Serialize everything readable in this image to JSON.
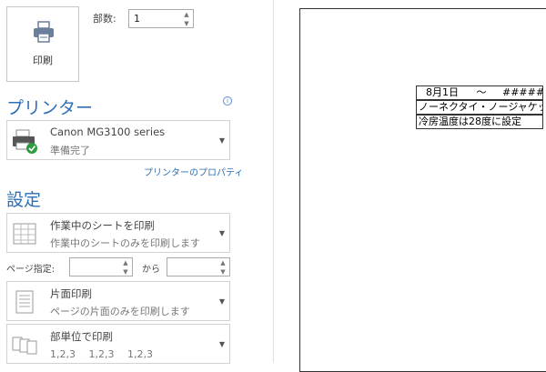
{
  "print": {
    "button_label": "印刷"
  },
  "copies": {
    "label": "部数:",
    "value": "1"
  },
  "printer": {
    "section_title": "プリンター",
    "name": "Canon MG3100 series",
    "status": "準備完了",
    "properties_link": "プリンターのプロパティ"
  },
  "settings": {
    "section_title": "設定",
    "what_to_print": {
      "title": "作業中のシートを印刷",
      "subtitle": "作業中のシートのみを印刷します"
    },
    "pages": {
      "label": "ページ指定:",
      "from_value": "",
      "to_label": "から",
      "to_value": ""
    },
    "sides": {
      "title": "片面印刷",
      "subtitle": "ページの片面のみを印刷します"
    },
    "collate": {
      "title": "部単位で印刷",
      "subtitle": "1,2,3　 1,2,3　 1,2,3"
    }
  },
  "preview": {
    "row1": {
      "date": "8月1日",
      "tilde": "～",
      "hash": "#####"
    },
    "row2": "ノーネクタイ・ノージャケット",
    "row3": "冷房温度は28度に設定"
  },
  "colors": {
    "accent": "#2e6fb5",
    "border": "#d2d2d2"
  }
}
